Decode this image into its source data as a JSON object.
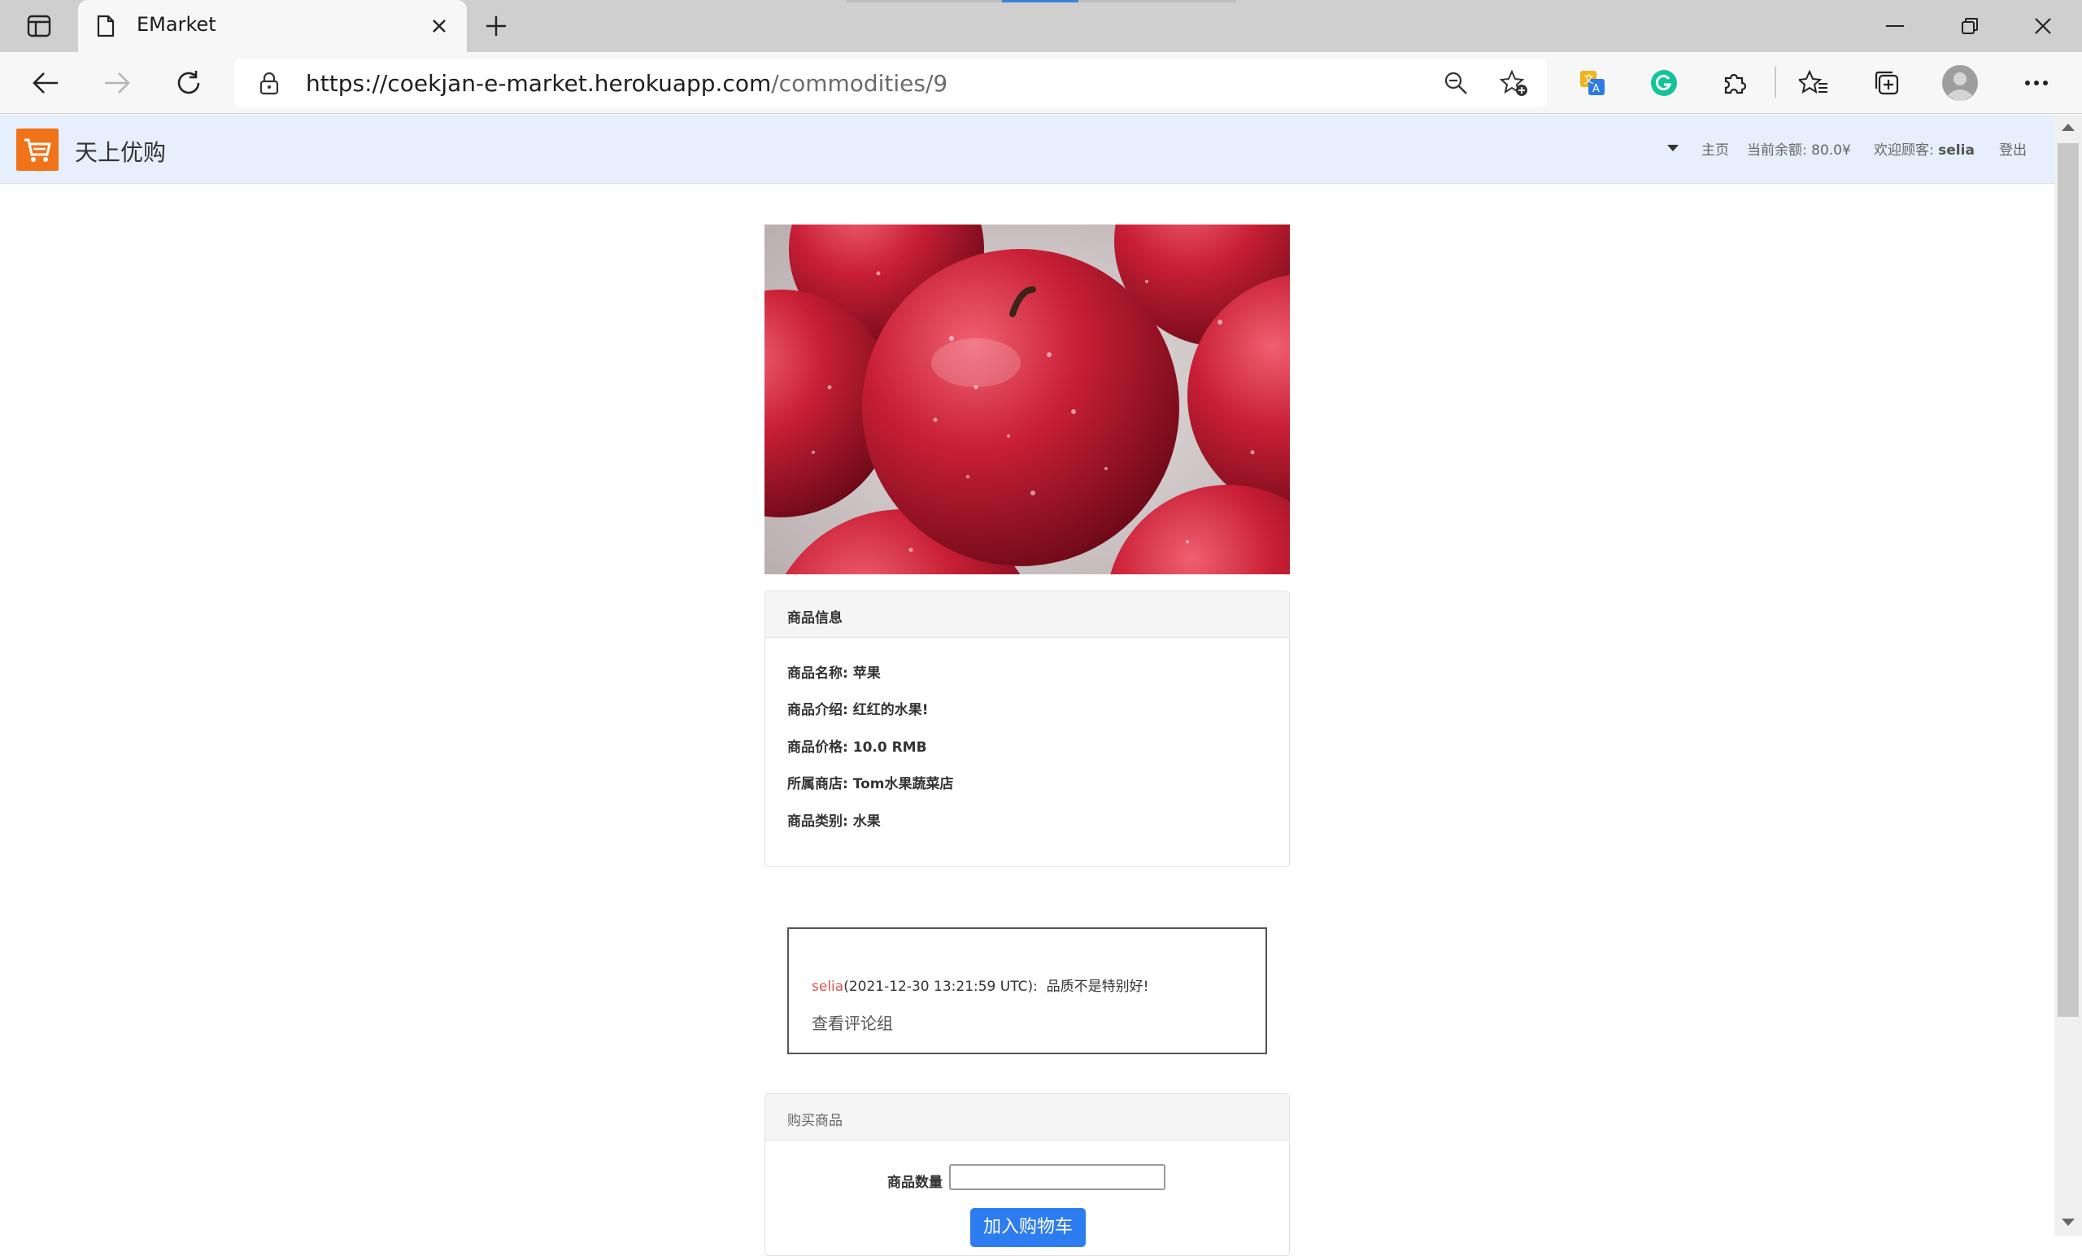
{
  "browser": {
    "tab_title": "EMarket",
    "url_host": "https://coekjan-e-market.herokuapp.com",
    "url_path": "/commodities/9"
  },
  "site": {
    "brand": "天上优购",
    "nav": {
      "home": "主页",
      "balance_label": "当前余额:",
      "balance_value": "80.0¥",
      "welcome_label": "欢迎顾客:",
      "username": "selia",
      "logout": "登出"
    }
  },
  "product": {
    "image_alt": "苹果",
    "info_title": "商品信息",
    "fields": [
      {
        "label": "商品名称:",
        "value": "苹果"
      },
      {
        "label": "商品介绍:",
        "value": "红红的水果!"
      },
      {
        "label": "商品价格:",
        "value": "10.0 RMB"
      },
      {
        "label": "所属商店:",
        "value": "Tom水果蔬菜店"
      },
      {
        "label": "商品类别:",
        "value": "水果"
      }
    ]
  },
  "comment": {
    "user": "selia",
    "time": "(2021-12-30 13:21:59 UTC):",
    "text": "品质不是特别好!",
    "view_group_link": "查看评论组"
  },
  "purchase": {
    "title": "购买商品",
    "qty_label": "商品数量",
    "qty_value": "",
    "button": "加入购物车"
  },
  "colors": {
    "navbar_bg": "#e6effb",
    "logo_orange": "#f07319",
    "button_blue": "#2d7cf0",
    "comment_user_red": "#d9534f"
  }
}
